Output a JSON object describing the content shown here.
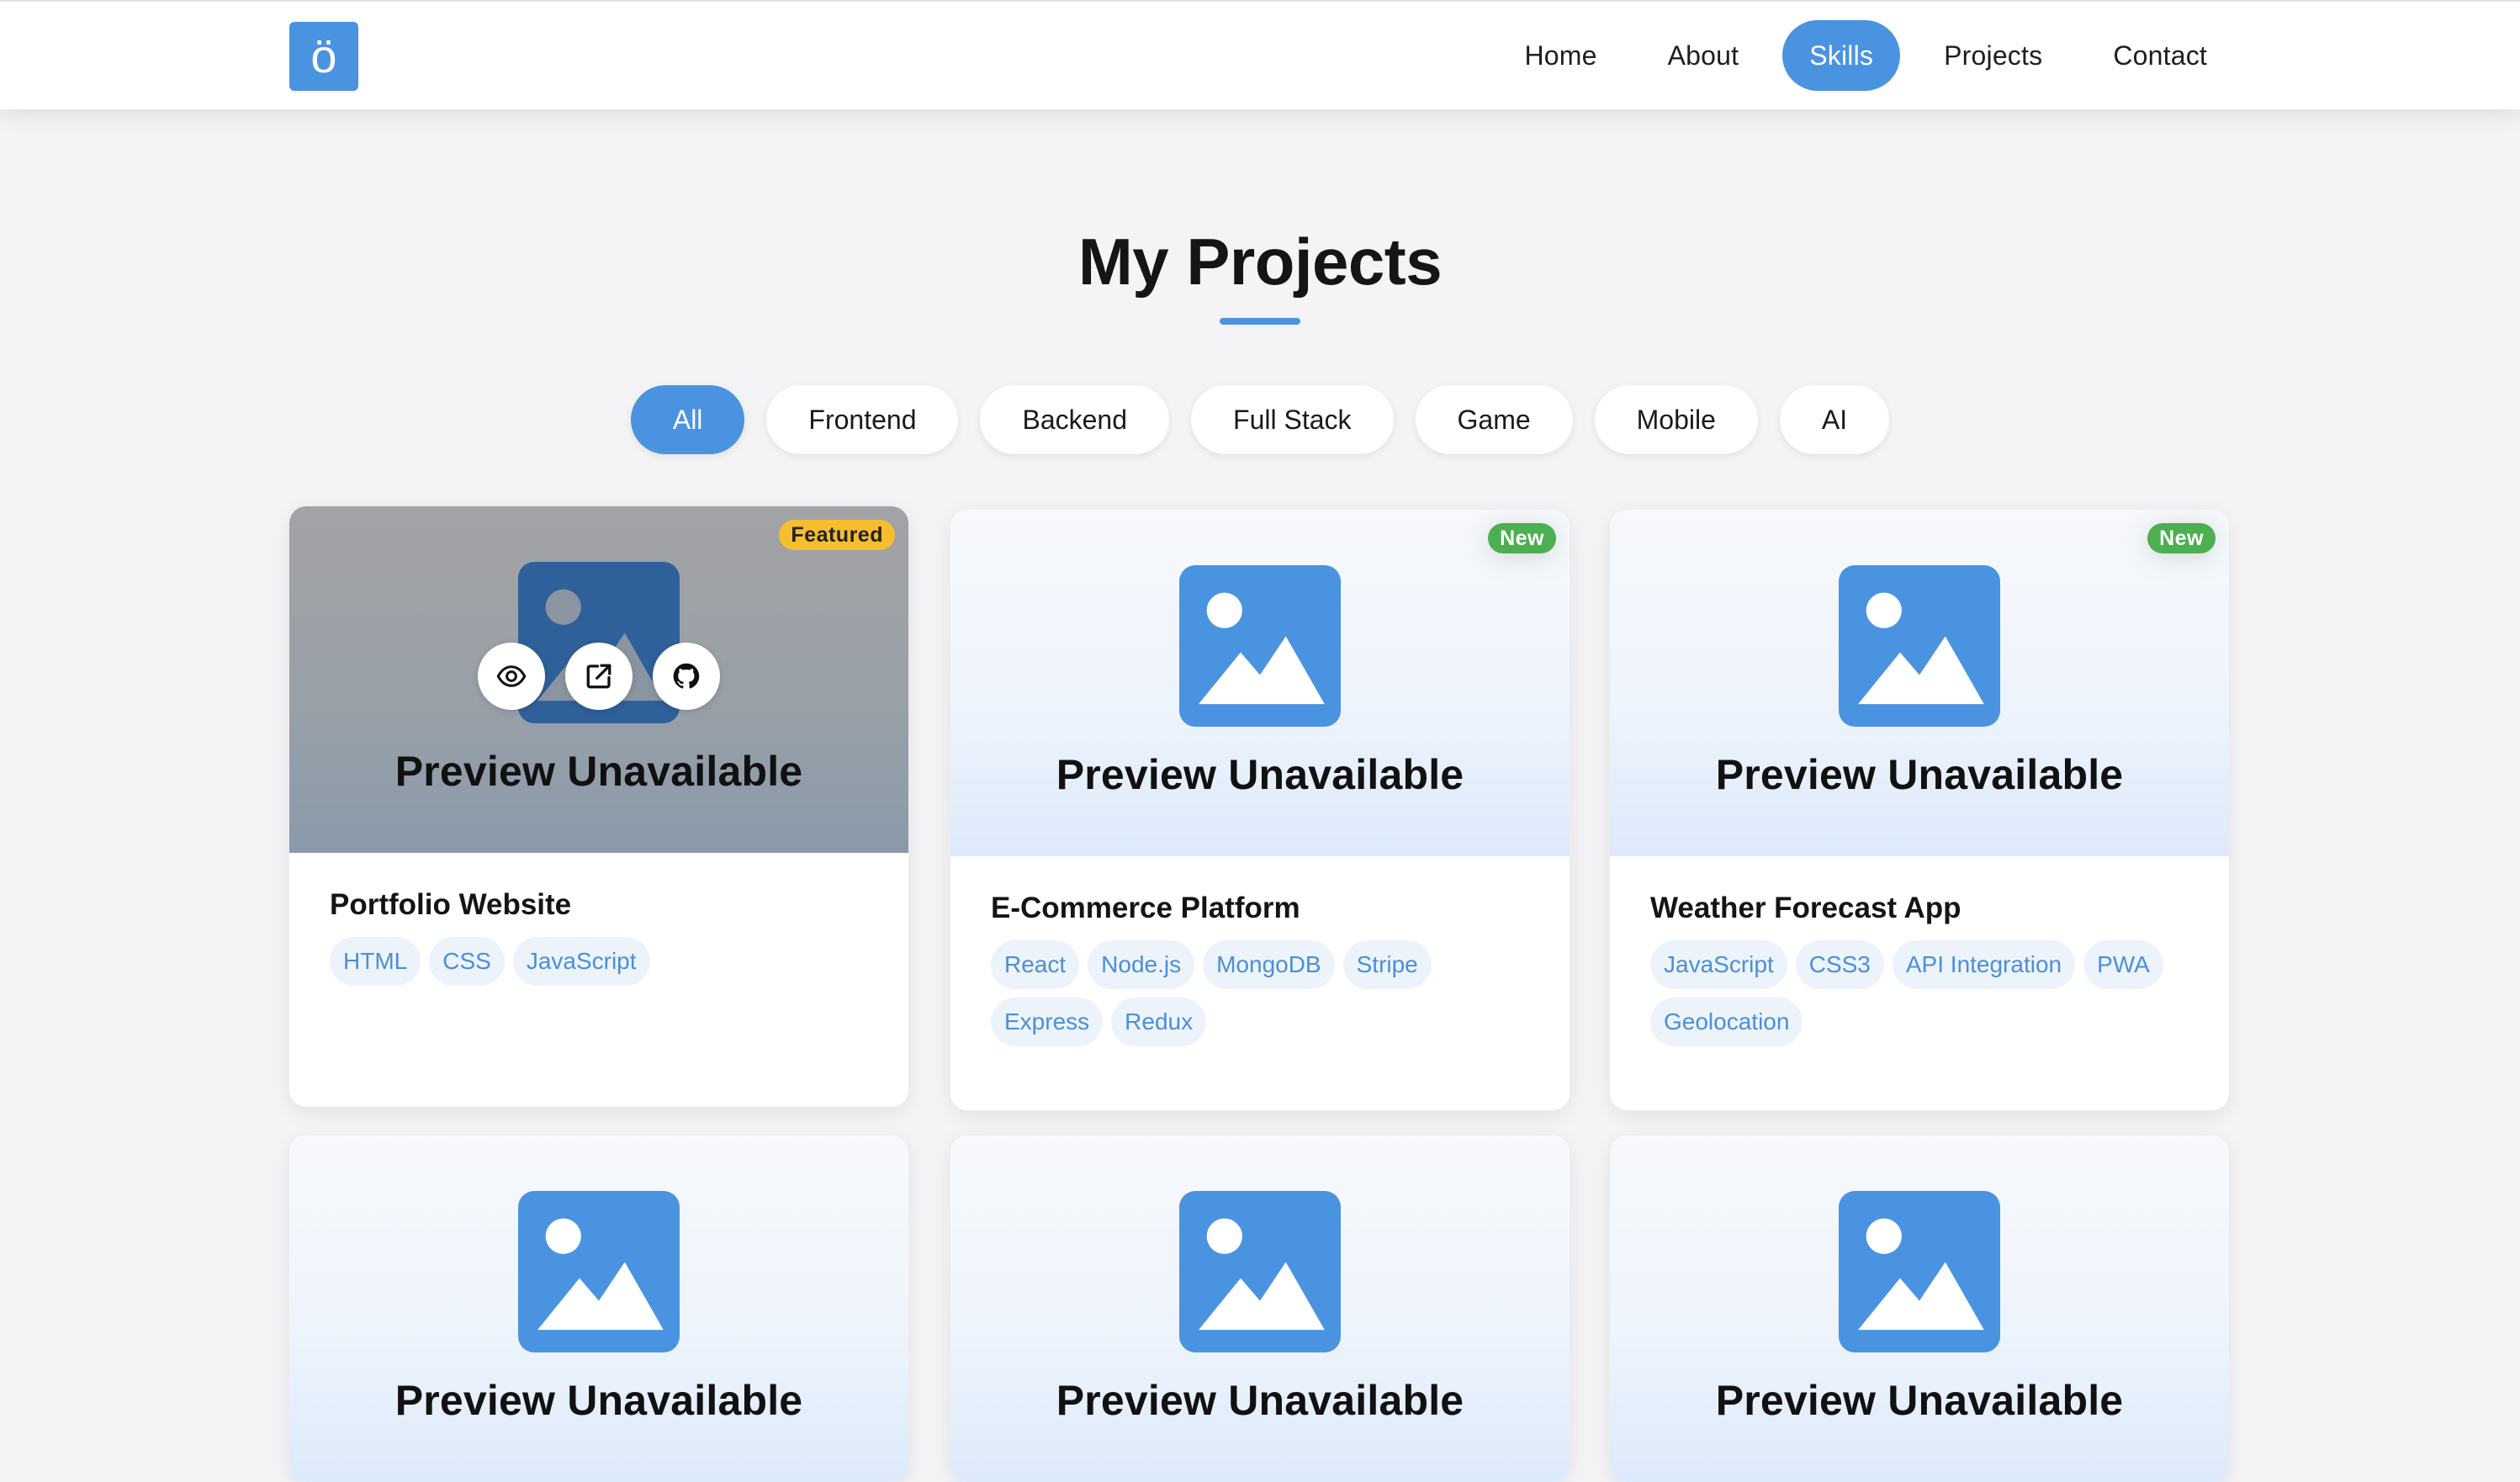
{
  "navbar": {
    "logo": "ö",
    "links": [
      {
        "label": "Home"
      },
      {
        "label": "About"
      },
      {
        "label": "Skills"
      },
      {
        "label": "Projects"
      },
      {
        "label": "Contact"
      }
    ],
    "active": "Skills"
  },
  "section": {
    "title": "My Projects"
  },
  "filters": [
    {
      "label": "All"
    },
    {
      "label": "Frontend"
    },
    {
      "label": "Backend"
    },
    {
      "label": "Full Stack"
    },
    {
      "label": "Game"
    },
    {
      "label": "Mobile"
    },
    {
      "label": "AI"
    }
  ],
  "active_filter": "All",
  "preview_text": "Preview Unavailable",
  "projects": [
    {
      "title": "Portfolio Website",
      "badge": "Featured",
      "tags": [
        "HTML",
        "CSS",
        "JavaScript"
      ]
    },
    {
      "title": "E-Commerce Platform",
      "badge": "New",
      "tags": [
        "React",
        "Node.js",
        "MongoDB",
        "Stripe",
        "Express",
        "Redux"
      ]
    },
    {
      "title": "Weather Forecast App",
      "badge": "New",
      "tags": [
        "JavaScript",
        "CSS3",
        "API Integration",
        "PWA",
        "Geolocation"
      ]
    },
    {
      "preview": "Preview Unavailable"
    },
    {
      "preview": "Preview Unavailable"
    },
    {
      "preview": "Preview Unavailable"
    }
  ],
  "card_actions": [
    {
      "icon": "eye-icon"
    },
    {
      "icon": "external-link-icon"
    },
    {
      "icon": "github-icon"
    }
  ],
  "colors": {
    "accent": "#4a93e0",
    "featured_badge": "#f6be2f",
    "new_badge": "#4caf50",
    "tag_bg": "#edf3fb",
    "tag_text": "#4a8fd9"
  }
}
